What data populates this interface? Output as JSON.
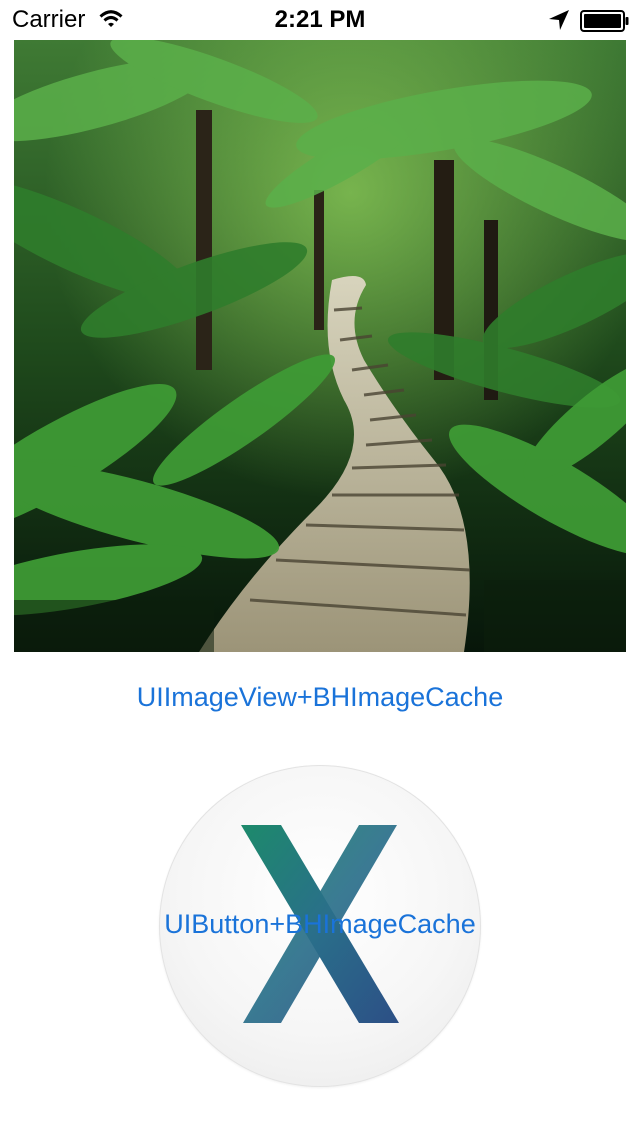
{
  "status_bar": {
    "carrier": "Carrier",
    "time": "2:21 PM",
    "icons": [
      "wifi-icon",
      "location-icon",
      "battery-icon"
    ]
  },
  "photo": {
    "subject": "forest-boardwalk-photo"
  },
  "imageview": {
    "label": "UIImageView+BHImageCache"
  },
  "round_button": {
    "icon": "x-logo-icon",
    "label": "UIButton+BHImageCache"
  },
  "colors": {
    "link_blue": "#1a73d9",
    "background": "#ffffff",
    "foliage_dark": "#0d2a10",
    "foliage_light": "#4fa83a",
    "boardwalk": "#b9b398"
  }
}
